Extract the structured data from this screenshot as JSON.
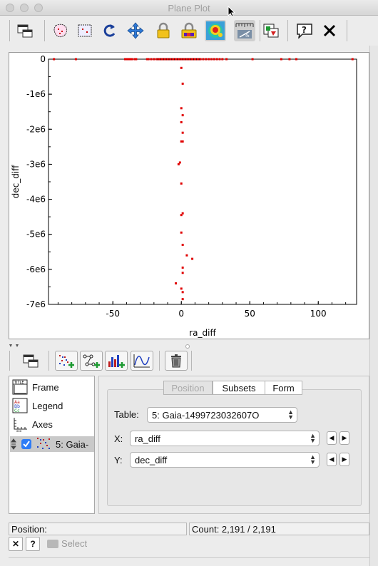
{
  "window": {
    "title": "Plane Plot"
  },
  "toolbar": {
    "icons": [
      "window-icon",
      "blob-subset-icon",
      "region-subset-icon",
      "replot-icon",
      "navigate-icon",
      "axis-lock-icon",
      "aux-lock-icon",
      "heatmap-icon",
      "legend-icon",
      "export-icon",
      "help-icon",
      "close-icon"
    ]
  },
  "plot": {
    "xlabel": "ra_diff",
    "ylabel": "dec_diff",
    "xticks": [
      "-50",
      "0",
      "50",
      "100"
    ],
    "yticks": [
      "0",
      "-1e6",
      "-2e6",
      "-3e6",
      "-4e6",
      "-5e6",
      "-6e6",
      "-7e6"
    ],
    "point_color": "#e00000"
  },
  "chart_data": {
    "type": "scatter",
    "title": "",
    "xlabel": "ra_diff",
    "ylabel": "dec_diff",
    "xlim": [
      -97,
      128
    ],
    "ylim": [
      -7000000,
      0
    ],
    "series": [
      {
        "x": [
          -93,
          -77,
          -41,
          -40,
          -39,
          -38,
          -37,
          -36,
          -34,
          -33,
          -25,
          -24,
          -22,
          -20,
          -18,
          -16,
          -14,
          -12,
          -10,
          -8,
          -6,
          -4,
          -2,
          0,
          2,
          4,
          6,
          8,
          10,
          12,
          14,
          16,
          18,
          20,
          22,
          24,
          26,
          28,
          30,
          33,
          52,
          73,
          79,
          84,
          125,
          0,
          1,
          0,
          1,
          0,
          1,
          1,
          0,
          -1,
          -2,
          0,
          0,
          1,
          0,
          1,
          4,
          8,
          1,
          1,
          -4,
          0,
          1,
          1
        ],
        "y": [
          0,
          0,
          0,
          0,
          0,
          0,
          0,
          0,
          0,
          0,
          0,
          0,
          0,
          0,
          0,
          0,
          0,
          0,
          0,
          0,
          0,
          0,
          0,
          0,
          0,
          0,
          0,
          0,
          0,
          0,
          0,
          0,
          0,
          0,
          0,
          0,
          0,
          0,
          0,
          0,
          0,
          0,
          0,
          0,
          0,
          -250000,
          -700000,
          -1400000,
          -1600000,
          -1800000,
          -2100000,
          -2350000,
          -2350000,
          -2950000,
          -3000000,
          -3550000,
          -4450000,
          -4400000,
          -4950000,
          -5300000,
          -5600000,
          -5700000,
          -5950000,
          -6100000,
          -6400000,
          -6550000,
          -6650000,
          -6850000
        ]
      }
    ]
  },
  "layer_toolbar": {
    "icons": [
      "window-icon",
      "add-position-layer-icon",
      "add-pair-layer-icon",
      "add-histogram-layer-icon",
      "add-function-layer-icon",
      "delete-layer-icon"
    ]
  },
  "tree": {
    "items": [
      {
        "label": "Frame"
      },
      {
        "label": "Legend"
      },
      {
        "label": "Axes"
      },
      {
        "label": "5: Gaia-"
      }
    ]
  },
  "tabs": {
    "position": "Position",
    "subsets": "Subsets",
    "form": "Form"
  },
  "config": {
    "table_label": "Table:",
    "table_value": "5: Gaia-1499723032607O",
    "x_label": "X:",
    "x_value": "ra_diff",
    "y_label": "Y:",
    "y_value": "dec_diff"
  },
  "status": {
    "position": "Position:",
    "count": "Count: 2,191 / 2,191",
    "select": "Select"
  }
}
